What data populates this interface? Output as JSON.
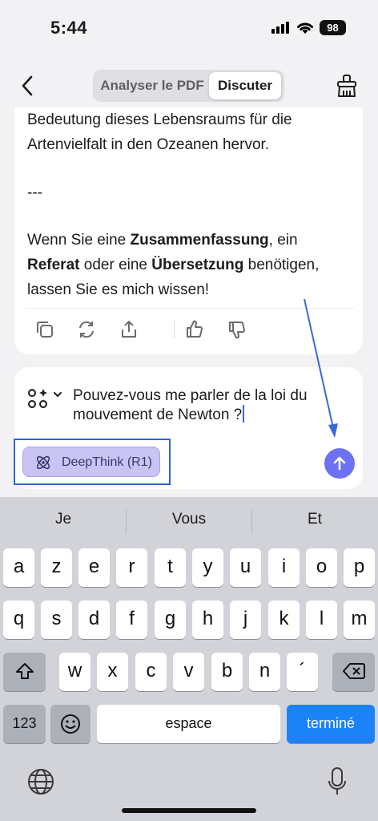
{
  "status": {
    "time": "5:44",
    "battery": "98"
  },
  "header": {
    "tabs": [
      {
        "label": "Analyser le PDF"
      },
      {
        "label": "Discuter"
      }
    ],
    "active_tab": "Discuter"
  },
  "message": {
    "line1": "Bedeutung dieses Lebensraums für die",
    "line2": "Artenvielfalt in den Ozeanen hervor.",
    "separator": "---",
    "closing": {
      "t1": "Wenn Sie eine ",
      "b1": "Zusammenfassung",
      "t2": ", ein",
      "b2": "Referat",
      "t3": " oder eine ",
      "b3": "Übersetzung",
      "t4": " benötigen,",
      "t5": "lassen Sie es mich wissen!"
    },
    "actions": [
      "copy-icon",
      "regenerate-icon",
      "share-icon",
      "thumbs-up-icon",
      "thumbs-down-icon"
    ]
  },
  "composer": {
    "text": "Pouvez-vous me parler de la loi du mouvement de Newton ?",
    "deepthink_label": "DeepThink (R1)"
  },
  "keyboard": {
    "suggestions": [
      "Je",
      "Vous",
      "Et"
    ],
    "row1": [
      "a",
      "z",
      "e",
      "r",
      "t",
      "y",
      "u",
      "i",
      "o",
      "p"
    ],
    "row2": [
      "q",
      "s",
      "d",
      "f",
      "g",
      "h",
      "j",
      "k",
      "l",
      "m"
    ],
    "row3": [
      "w",
      "x",
      "c",
      "v",
      "b",
      "n",
      "´"
    ],
    "numbers_key": "123",
    "space_key": "espace",
    "done_key": "terminé"
  },
  "colors": {
    "accent": "#6d72f3",
    "deepthink_bg": "#c9c4f3",
    "annotation": "#2f63d4",
    "done_key": "#1b82f7"
  }
}
